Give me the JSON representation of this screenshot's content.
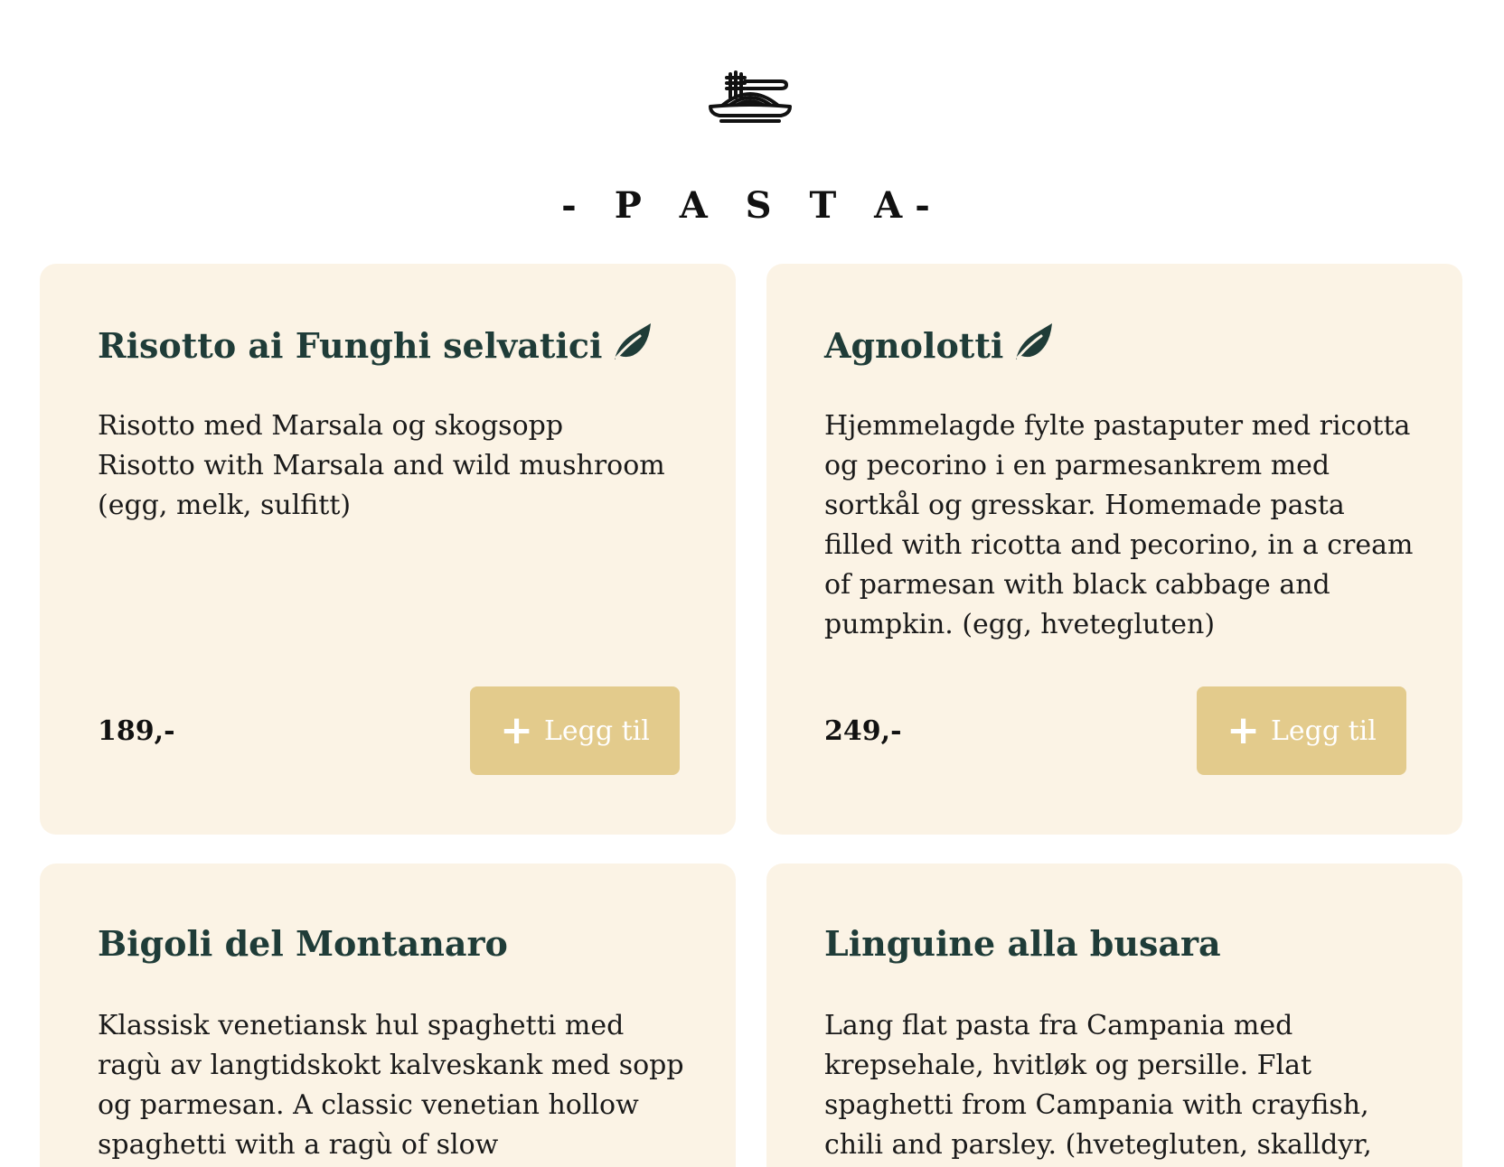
{
  "section": {
    "title": "- P A S T A-"
  },
  "colors": {
    "card_bg": "#fbf3e5",
    "title": "#1f3c38",
    "button_bg": "#e3cb8c",
    "button_text": "#ffffff"
  },
  "icons": {
    "logo": "pasta-plate-icon",
    "vegetarian": "leaf-icon",
    "add": "plus-icon"
  },
  "dishes": [
    {
      "name": "Risotto ai Funghi selvatici",
      "vegetarian": true,
      "description_lines": [
        "Risotto med Marsala og skogsopp",
        "Risotto with Marsala and wild mushroom",
        "(egg, melk, sulfitt)"
      ],
      "price": "189,-",
      "button_label": "Legg til"
    },
    {
      "name": "Agnolotti",
      "vegetarian": true,
      "description": "Hjemmelagde fylte pastaputer med ricotta og pecorino i en parmesankrem med sortkål og gresskar. Homemade pasta filled with ricotta and pecorino, in a cream of parmesan with black cabbage and pumpkin. (egg, hvetegluten)",
      "price": "249,-",
      "button_label": "Legg til"
    },
    {
      "name": "Bigoli del Montanaro",
      "vegetarian": false,
      "description": "Klassisk venetiansk hul spaghetti med ragù av langtidskokt kalveskank med sopp og parmesan. A classic venetian hollow spaghetti with a ragù of slow"
    },
    {
      "name": "Linguine alla busara",
      "vegetarian": false,
      "description": "Lang flat pasta fra Campania med krepsehale, hvitløk og persille. Flat spaghetti from Campania with crayfish, chili and parsley. (hvetegluten, skalldyr,"
    }
  ]
}
